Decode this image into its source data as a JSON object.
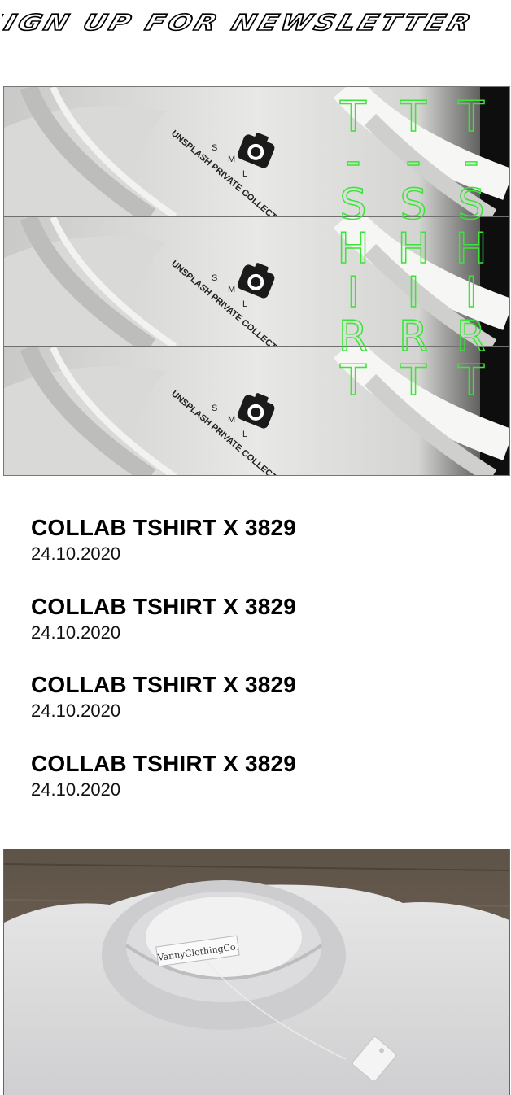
{
  "marquee": {
    "text": "SIGN UP FOR NEWSLETTER"
  },
  "banner": {
    "label_text": "UNSPLASH PRIVATE COLLECTION",
    "sizes": [
      "S",
      "M",
      "L"
    ],
    "vertical_word": [
      "T",
      "-",
      "S",
      "H",
      "I",
      "R",
      "T"
    ],
    "accent_color": "#39e535"
  },
  "items": [
    {
      "title": "COLLAB TSHIRT X 3829",
      "date": "24.10.2020"
    },
    {
      "title": "COLLAB TSHIRT X 3829",
      "date": "24.10.2020"
    },
    {
      "title": "COLLAB TSHIRT X 3829",
      "date": "24.10.2020"
    },
    {
      "title": "COLLAB TSHIRT X 3829",
      "date": "24.10.2020"
    }
  ],
  "photo": {
    "tag_text": "VannyClothingCo."
  }
}
